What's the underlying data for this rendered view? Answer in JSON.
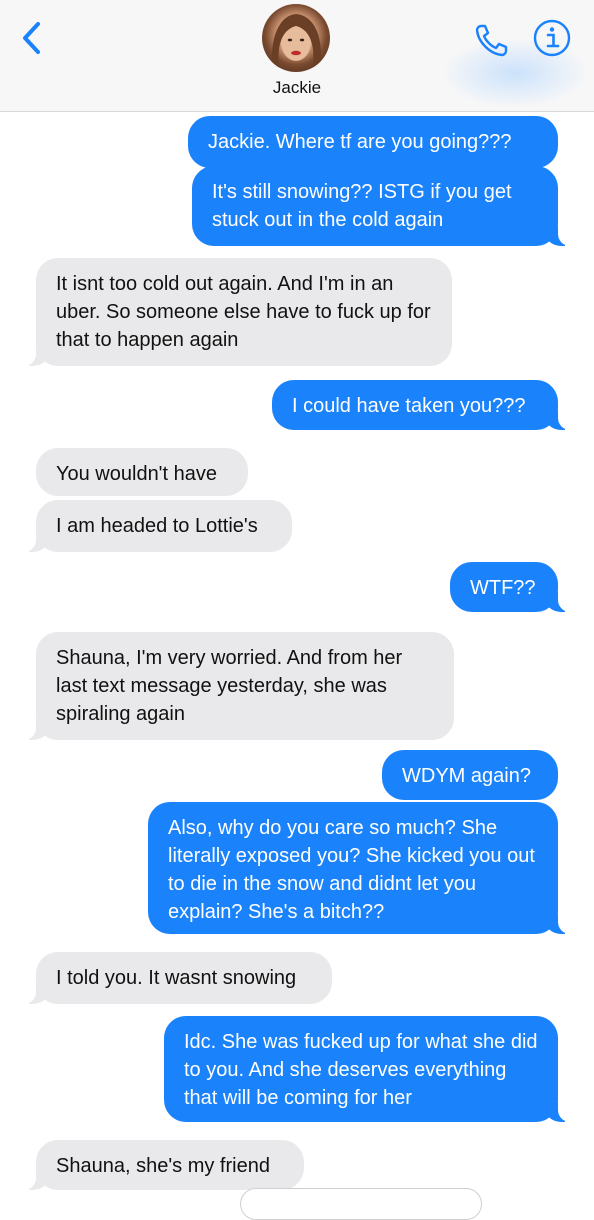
{
  "header": {
    "contact_name": "Jackie",
    "back_icon": "chevron-left-icon",
    "call_icon": "phone-icon",
    "info_icon": "info-icon",
    "accent_color": "#1a82fb"
  },
  "messages": [
    {
      "dir": "out",
      "text": "Jackie. Where tf are you going???"
    },
    {
      "dir": "out",
      "text": "It's still snowing?? ISTG if you get stuck out in the cold again"
    },
    {
      "dir": "in",
      "text": "It isnt too cold out again. And I'm in an uber. So someone else have to fuck up for that to happen again"
    },
    {
      "dir": "out",
      "text": "I could have taken you???"
    },
    {
      "dir": "in",
      "text": "You wouldn't have"
    },
    {
      "dir": "in",
      "text": "I am headed to Lottie's"
    },
    {
      "dir": "out",
      "text": "WTF??"
    },
    {
      "dir": "in",
      "text": "Shauna, I'm very worried. And from her last text message yesterday, she was spiraling again"
    },
    {
      "dir": "out",
      "text": "WDYM again?"
    },
    {
      "dir": "out",
      "text": "Also, why do you care so much? She literally exposed you? She kicked you out to die in the snow and didnt let you explain? She's a bitch??"
    },
    {
      "dir": "in",
      "text": "I told you. It wasnt snowing"
    },
    {
      "dir": "out",
      "text": "Idc. She was fucked up for what she did to you. And she deserves everything that will be coming for her"
    },
    {
      "dir": "in",
      "text": "Shauna, she's my friend"
    }
  ]
}
